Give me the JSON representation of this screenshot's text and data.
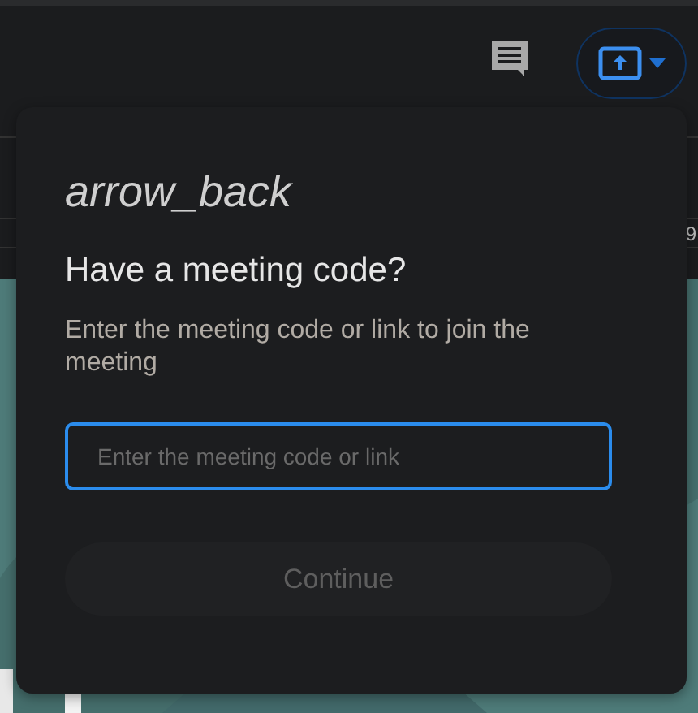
{
  "toolbar": {
    "share_button": {
      "menu": true
    }
  },
  "background": {
    "ruler_text": "9"
  },
  "dialog": {
    "back": "arrow_back",
    "title": "Have a meeting code?",
    "description": "Enter the meeting code or link to join the meeting",
    "code_field": {
      "placeholder": "Enter the meeting code or link",
      "focused": true
    },
    "continue_button": {
      "label": "Continue",
      "disabled": true
    }
  }
}
